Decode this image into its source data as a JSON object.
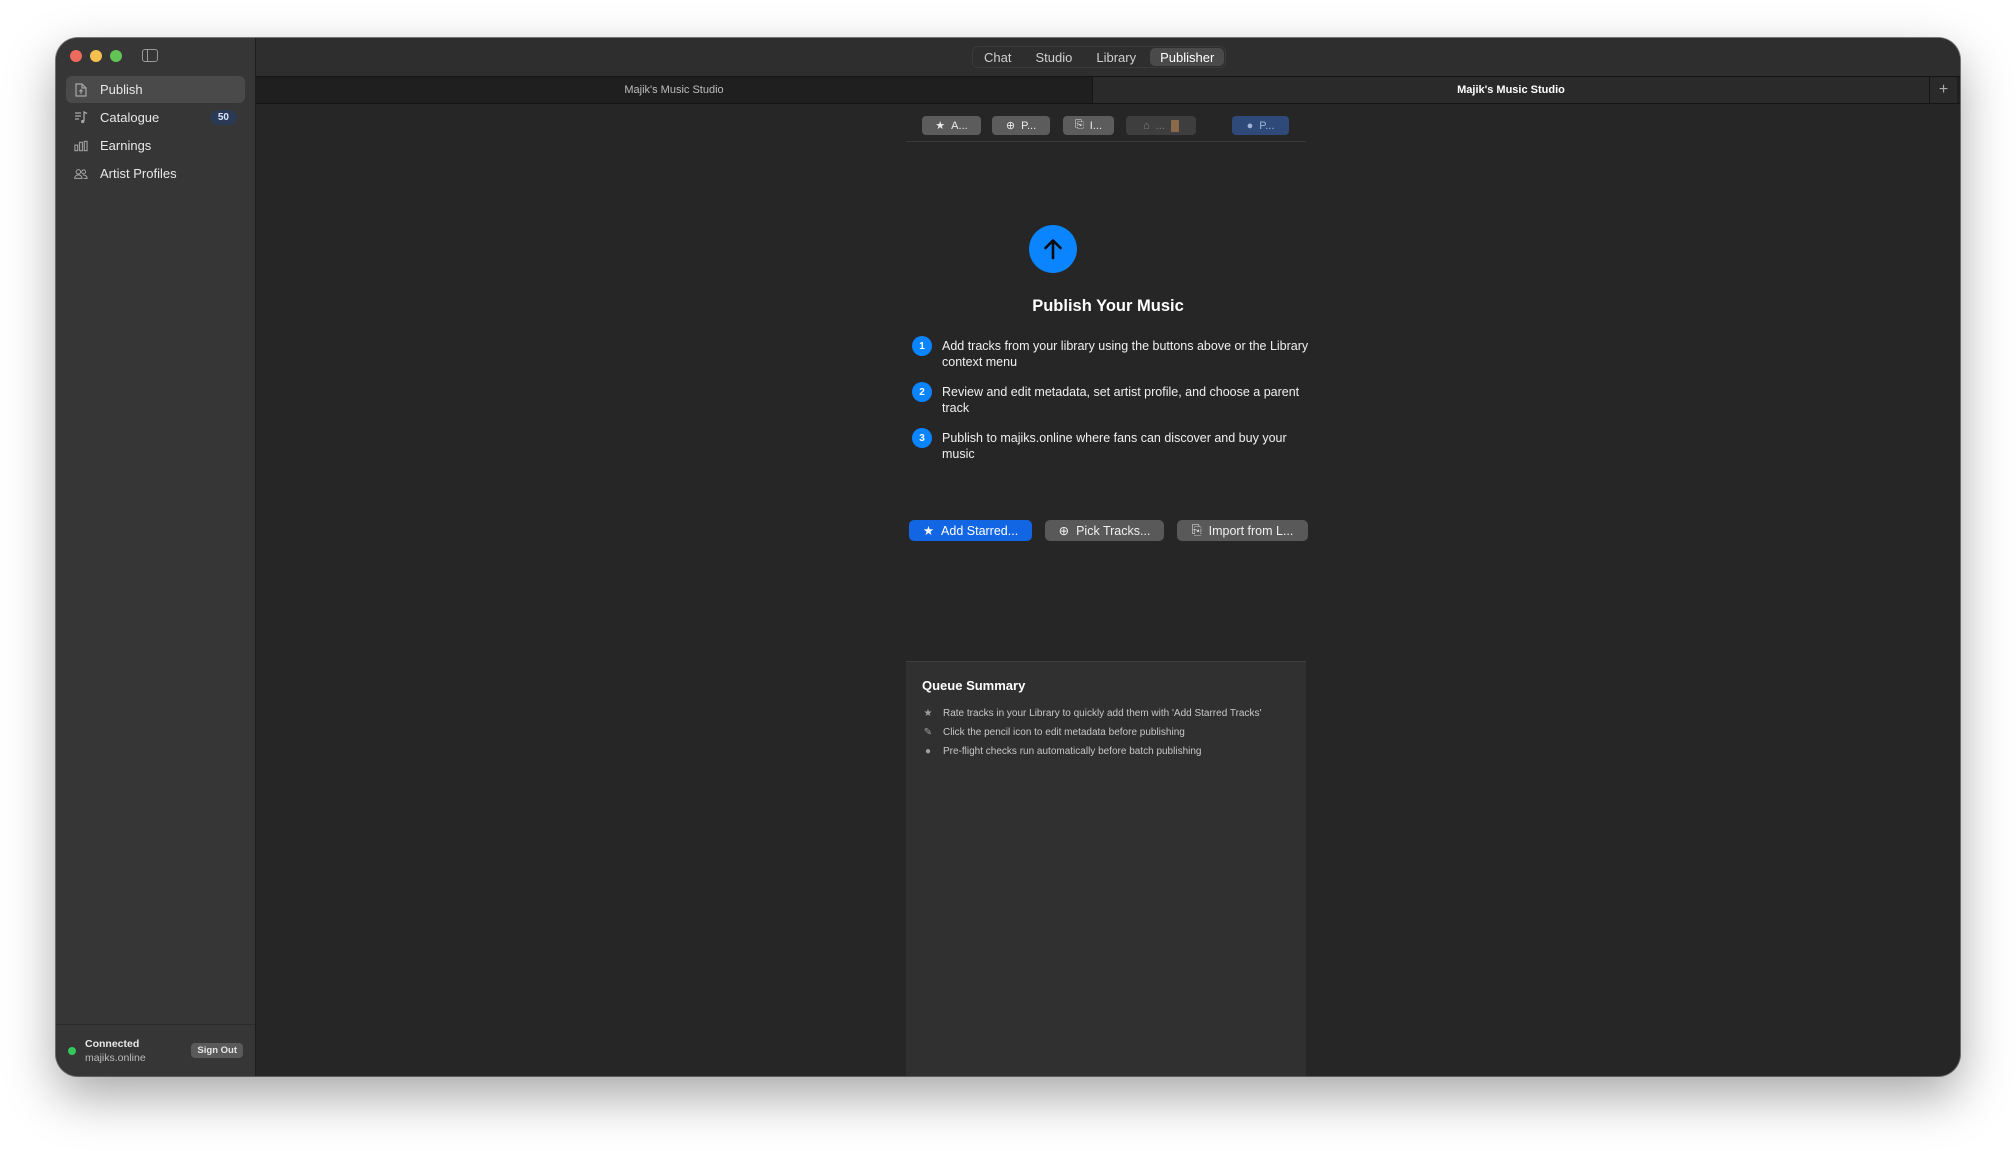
{
  "sidebar": {
    "items": [
      {
        "label": "Publish",
        "icon": "document-icon",
        "active": true
      },
      {
        "label": "Catalogue",
        "icon": "music-list-icon",
        "badge": "50"
      },
      {
        "label": "Earnings",
        "icon": "bar-chart-icon"
      },
      {
        "label": "Artist Profiles",
        "icon": "people-icon"
      }
    ],
    "footer": {
      "status": "Connected",
      "host": "majiks.online",
      "sign_out": "Sign Out",
      "status_color": "#34c759"
    }
  },
  "titlebar": {
    "tabs": [
      "Chat",
      "Studio",
      "Library",
      "Publisher"
    ],
    "active_tab": "Publisher"
  },
  "doc_tabs": [
    "Majik's Music Studio",
    "Majik's Music Studio"
  ],
  "toolbar": {
    "buttons": [
      {
        "label": "A...",
        "icon": "star-icon"
      },
      {
        "label": "P...",
        "icon": "plus-circle-icon"
      },
      {
        "label": "I...",
        "icon": "import-icon"
      },
      {
        "label": "...",
        "icon": "home-icon"
      },
      {
        "label": "P...",
        "icon": "publish-circle-icon"
      }
    ]
  },
  "hero": {
    "title": "Publish Your Music",
    "accent": "#0a84ff"
  },
  "steps": [
    {
      "num": "1",
      "text": "Add tracks from your library using the buttons above or the Library context menu"
    },
    {
      "num": "2",
      "text": "Review and edit metadata, set artist profile, and choose a parent track"
    },
    {
      "num": "3",
      "text": "Publish to majiks.online where fans can discover and buy your music"
    }
  ],
  "actions": {
    "add_starred": "Add Starred...",
    "pick_tracks": "Pick Tracks...",
    "import": "Import from L..."
  },
  "queue": {
    "title": "Queue Summary",
    "tips": [
      {
        "icon": "star-icon",
        "text": "Rate tracks in your Library to quickly add them with 'Add Starred Tracks'"
      },
      {
        "icon": "pencil-icon",
        "text": "Click the pencil icon to edit metadata before publishing"
      },
      {
        "icon": "info-icon",
        "text": "Pre-flight checks run automatically before batch publishing"
      }
    ]
  }
}
